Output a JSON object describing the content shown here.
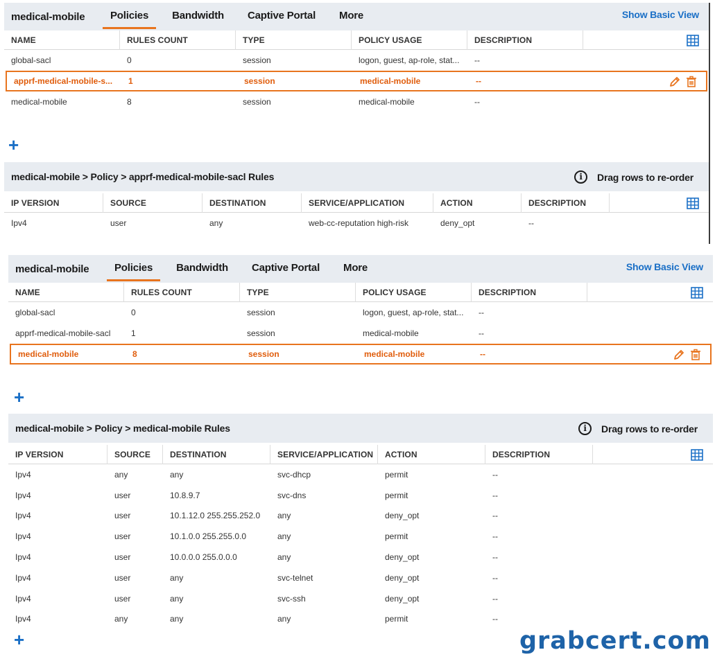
{
  "top": {
    "app_title": "medical-mobile",
    "tabs": [
      "Policies",
      "Bandwidth",
      "Captive Portal",
      "More"
    ],
    "show_basic_view": "Show Basic View",
    "policy_columns": [
      "NAME",
      "RULES COUNT",
      "TYPE",
      "POLICY USAGE",
      "DESCRIPTION"
    ],
    "policies": [
      {
        "name": "global-sacl",
        "rules_count": "0",
        "type": "session",
        "usage": "logon, guest, ap-role, stat...",
        "description": "--"
      },
      {
        "name": "apprf-medical-mobile-s...",
        "rules_count": "1",
        "type": "session",
        "usage": "medical-mobile",
        "description": "--"
      },
      {
        "name": "medical-mobile",
        "rules_count": "8",
        "type": "session",
        "usage": "medical-mobile",
        "description": "--"
      }
    ],
    "add_symbol": "+",
    "breadcrumb": "medical-mobile > Policy > apprf-medical-mobile-sacl Rules",
    "drag_hint": "Drag rows to re-order",
    "rule_columns": [
      "IP VERSION",
      "SOURCE",
      "DESTINATION",
      "SERVICE/APPLICATION",
      "ACTION",
      "DESCRIPTION"
    ],
    "rules": [
      {
        "ip": "Ipv4",
        "source": "user",
        "destination": "any",
        "service": "web-cc-reputation high-risk",
        "action": "deny_opt",
        "description": "--"
      }
    ]
  },
  "bottom": {
    "app_title": "medical-mobile",
    "tabs": [
      "Policies",
      "Bandwidth",
      "Captive Portal",
      "More"
    ],
    "show_basic_view": "Show Basic View",
    "policy_columns": [
      "NAME",
      "RULES COUNT",
      "TYPE",
      "POLICY USAGE",
      "DESCRIPTION"
    ],
    "policies": [
      {
        "name": "global-sacl",
        "rules_count": "0",
        "type": "session",
        "usage": "logon, guest, ap-role, stat...",
        "description": "--"
      },
      {
        "name": "apprf-medical-mobile-sacl",
        "rules_count": "1",
        "type": "session",
        "usage": "medical-mobile",
        "description": "--"
      },
      {
        "name": "medical-mobile",
        "rules_count": "8",
        "type": "session",
        "usage": "medical-mobile",
        "description": "--"
      }
    ],
    "add_symbol": "+",
    "breadcrumb": "medical-mobile > Policy > medical-mobile Rules",
    "drag_hint": "Drag rows to re-order",
    "rule_columns": [
      "IP VERSION",
      "SOURCE",
      "DESTINATION",
      "SERVICE/APPLICATION",
      "ACTION",
      "DESCRIPTION"
    ],
    "rules": [
      {
        "ip": "Ipv4",
        "source": "any",
        "destination": "any",
        "service": "svc-dhcp",
        "action": "permit",
        "description": "--"
      },
      {
        "ip": "Ipv4",
        "source": "user",
        "destination": "10.8.9.7",
        "service": "svc-dns",
        "action": "permit",
        "description": "--"
      },
      {
        "ip": "Ipv4",
        "source": "user",
        "destination": "10.1.12.0 255.255.252.0",
        "service": "any",
        "action": "deny_opt",
        "description": "--"
      },
      {
        "ip": "Ipv4",
        "source": "user",
        "destination": "10.1.0.0 255.255.0.0",
        "service": "any",
        "action": "permit",
        "description": "--"
      },
      {
        "ip": "Ipv4",
        "source": "user",
        "destination": "10.0.0.0 255.0.0.0",
        "service": "any",
        "action": "deny_opt",
        "description": "--"
      },
      {
        "ip": "Ipv4",
        "source": "user",
        "destination": "any",
        "service": "svc-telnet",
        "action": "deny_opt",
        "description": "--"
      },
      {
        "ip": "Ipv4",
        "source": "user",
        "destination": "any",
        "service": "svc-ssh",
        "action": "deny_opt",
        "description": "--"
      },
      {
        "ip": "Ipv4",
        "source": "any",
        "destination": "any",
        "service": "any",
        "action": "permit",
        "description": "--"
      }
    ]
  },
  "watermark": "grabcert.com",
  "colors": {
    "accent": "#e8741e",
    "link": "#1a6fc6",
    "header_bg": "#e8ecf1"
  }
}
